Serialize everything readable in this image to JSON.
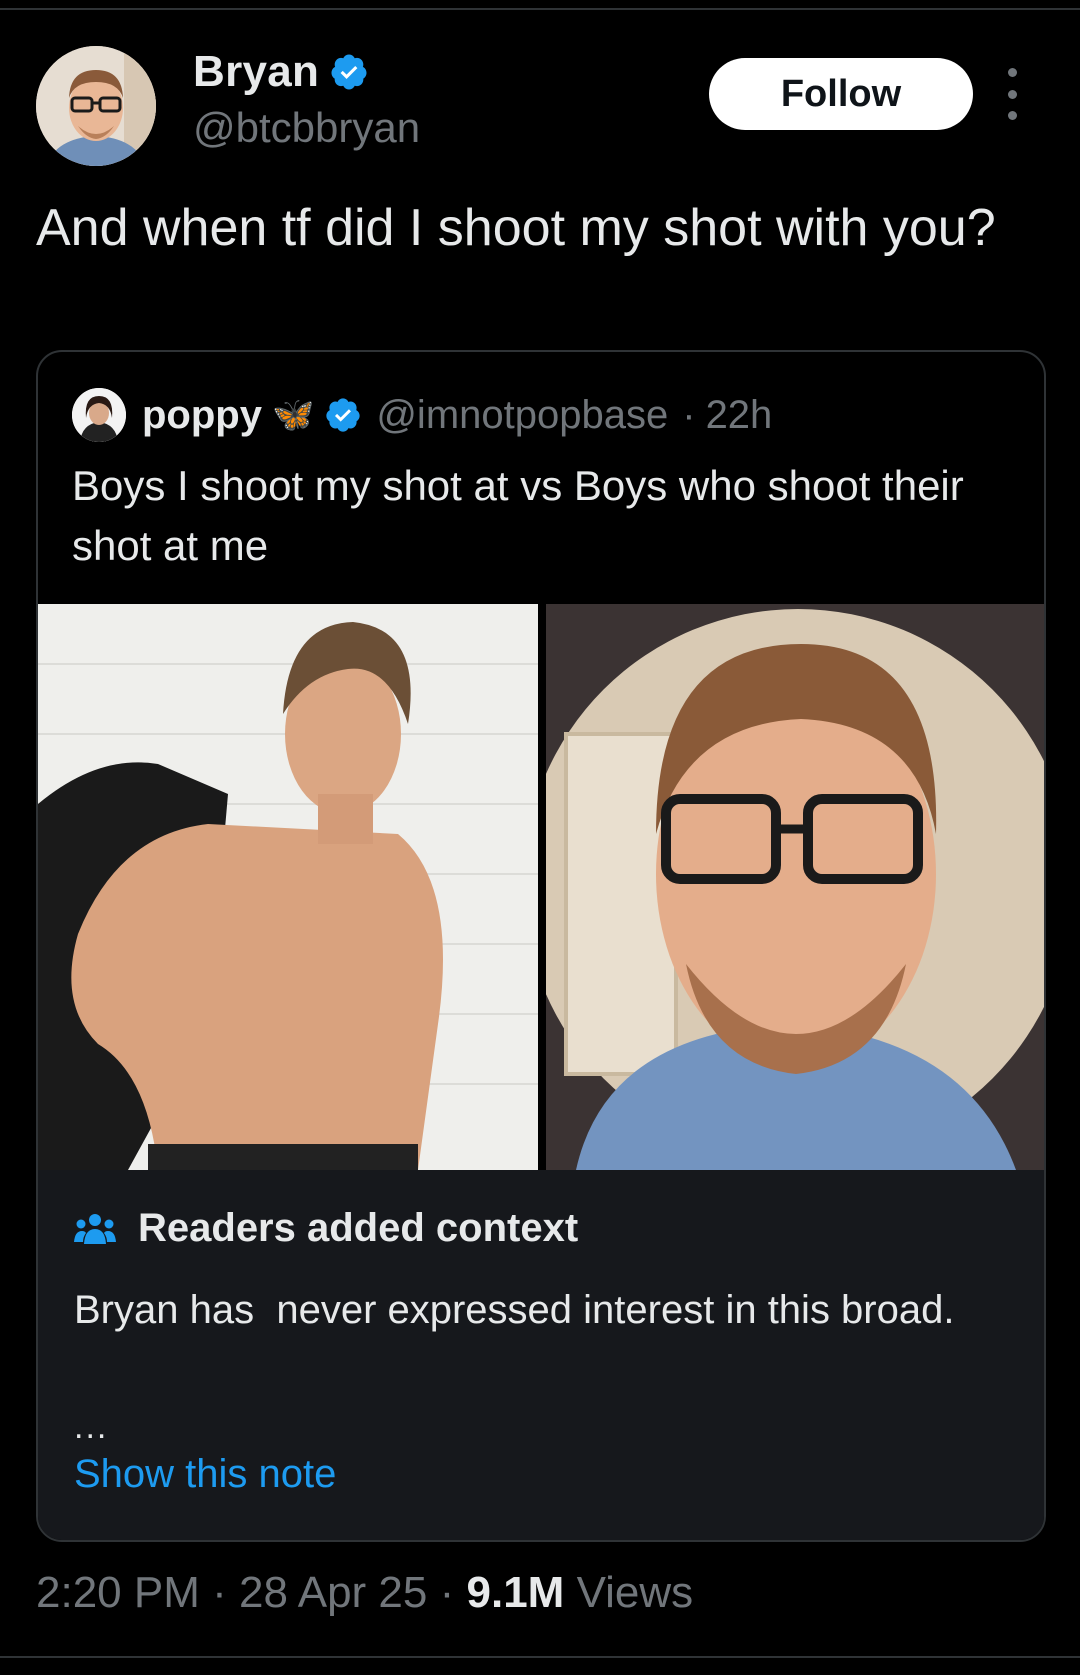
{
  "author": {
    "name": "Bryan",
    "handle": "@btcbbryan",
    "follow_label": "Follow"
  },
  "tweet": {
    "text": "And when tf did I shoot my shot with you?"
  },
  "quoted": {
    "name": "poppy",
    "emoji": "🦋",
    "handle": "@imnotpopbase",
    "separator": "·",
    "time": "22h",
    "text": "Boys I shoot my shot at vs Boys who shoot their shot at me"
  },
  "note": {
    "title": "Readers added context",
    "text": "Bryan has  never expressed interest in this broad.",
    "ellipsis": "...",
    "link": "Show this note"
  },
  "meta": {
    "time": "2:20 PM",
    "date": "28 Apr 25",
    "sep": "·",
    "views_count": "9.1M",
    "views_label": "Views"
  },
  "colors": {
    "accent": "#1d9bf0",
    "muted": "#71767b",
    "text": "#e7e9ea",
    "note_bg": "#16181c"
  }
}
